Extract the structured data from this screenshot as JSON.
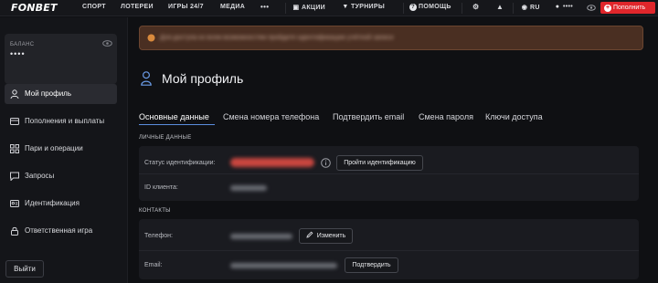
{
  "nav": {
    "logo": "FONBET",
    "items": [
      "СПОРТ",
      "ЛОТЕРЕИ",
      "ИГРЫ 24/7",
      "МЕДИА",
      "•••"
    ],
    "promo": "АКЦИИ",
    "tournaments": "ТУРНИРЫ",
    "help": "ПОМОЩЬ",
    "language": "RU",
    "account_masked": "••••",
    "deposit_label": "Пополнить"
  },
  "sidebar": {
    "balance_label": "БАЛАНС",
    "balance_value": "••••",
    "items": [
      {
        "label": "Мой профиль",
        "icon": "user-icon",
        "active": true
      },
      {
        "label": "Пополнения и выплаты",
        "icon": "wallet-icon",
        "active": false
      },
      {
        "label": "Пари и операции",
        "icon": "grid-icon",
        "active": false
      },
      {
        "label": "Запросы",
        "icon": "message-icon",
        "active": false
      },
      {
        "label": "Идентификация",
        "icon": "id-card-icon",
        "active": false
      },
      {
        "label": "Ответственная игра",
        "icon": "lock-icon",
        "active": false
      }
    ],
    "logout_label": "Выйти"
  },
  "main": {
    "banner_text": "Для доступа ко всем возможностям пройдите идентификацию учётной записи",
    "title": "Мой профиль",
    "tabs": [
      {
        "label": "Основные данные",
        "active": true
      },
      {
        "label": "Смена номера телефона",
        "active": false
      },
      {
        "label": "Подтвердить email",
        "active": false
      },
      {
        "label": "Смена пароля",
        "active": false
      },
      {
        "label": "Ключи доступа",
        "active": false
      }
    ],
    "personal": {
      "heading": "ЛИЧНЫЕ ДАННЫЕ",
      "status_label": "Статус идентификации:",
      "identify_button": "Пройти идентификацию",
      "client_id_label": "ID клиента:"
    },
    "contacts": {
      "heading": "КОНТАКТЫ",
      "phone_label": "Телефон:",
      "change_button": "Изменить",
      "email_label": "Email:",
      "confirm_button": "Подтвердить"
    }
  },
  "colors": {
    "accent_red": "#e0262b",
    "tab_underline": "#5a8dde",
    "warning_banner": "#4a2f22"
  }
}
